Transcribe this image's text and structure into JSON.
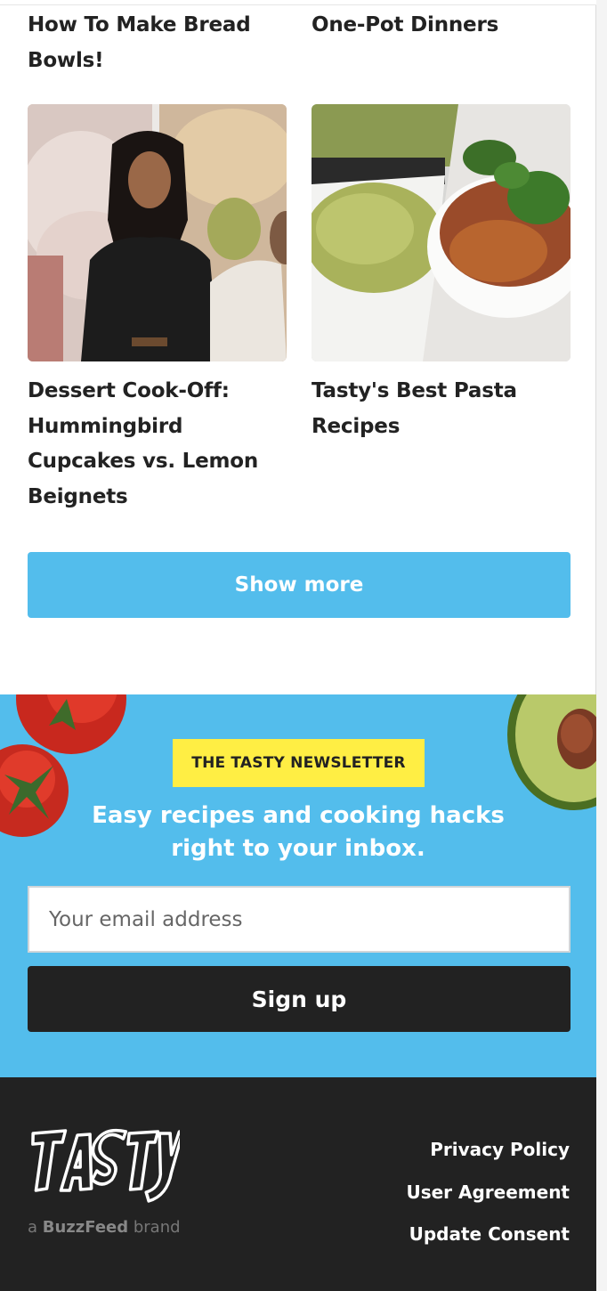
{
  "cards": [
    {
      "title_lines": [
        "How To Make Bread",
        "Bowls!"
      ]
    },
    {
      "title_lines": [
        "One-Pot Dinners"
      ]
    },
    {
      "title_lines": [
        "Dessert Cook-Off:",
        "Hummingbird",
        "Cupcakes vs. Lemon",
        "Beignets"
      ]
    },
    {
      "title_lines": [
        "Tasty's Best Pasta",
        "Recipes"
      ]
    }
  ],
  "show_more_label": "Show more",
  "newsletter": {
    "badge": "THE TASTY NEWSLETTER",
    "heading_lines": [
      "Easy recipes and cooking hacks",
      "right to your inbox."
    ],
    "email_placeholder": "Your email address",
    "signup_label": "Sign up"
  },
  "footer": {
    "logo_text": "TASTY",
    "brand_prefix": "a",
    "brand_name": "BuzzFeed",
    "brand_suffix": "brand",
    "links": [
      "Privacy Policy",
      "User Agreement",
      "Update Consent"
    ]
  },
  "colors": {
    "accent_blue": "#53bdec",
    "badge_yellow": "#ffee44",
    "dark": "#222222"
  }
}
